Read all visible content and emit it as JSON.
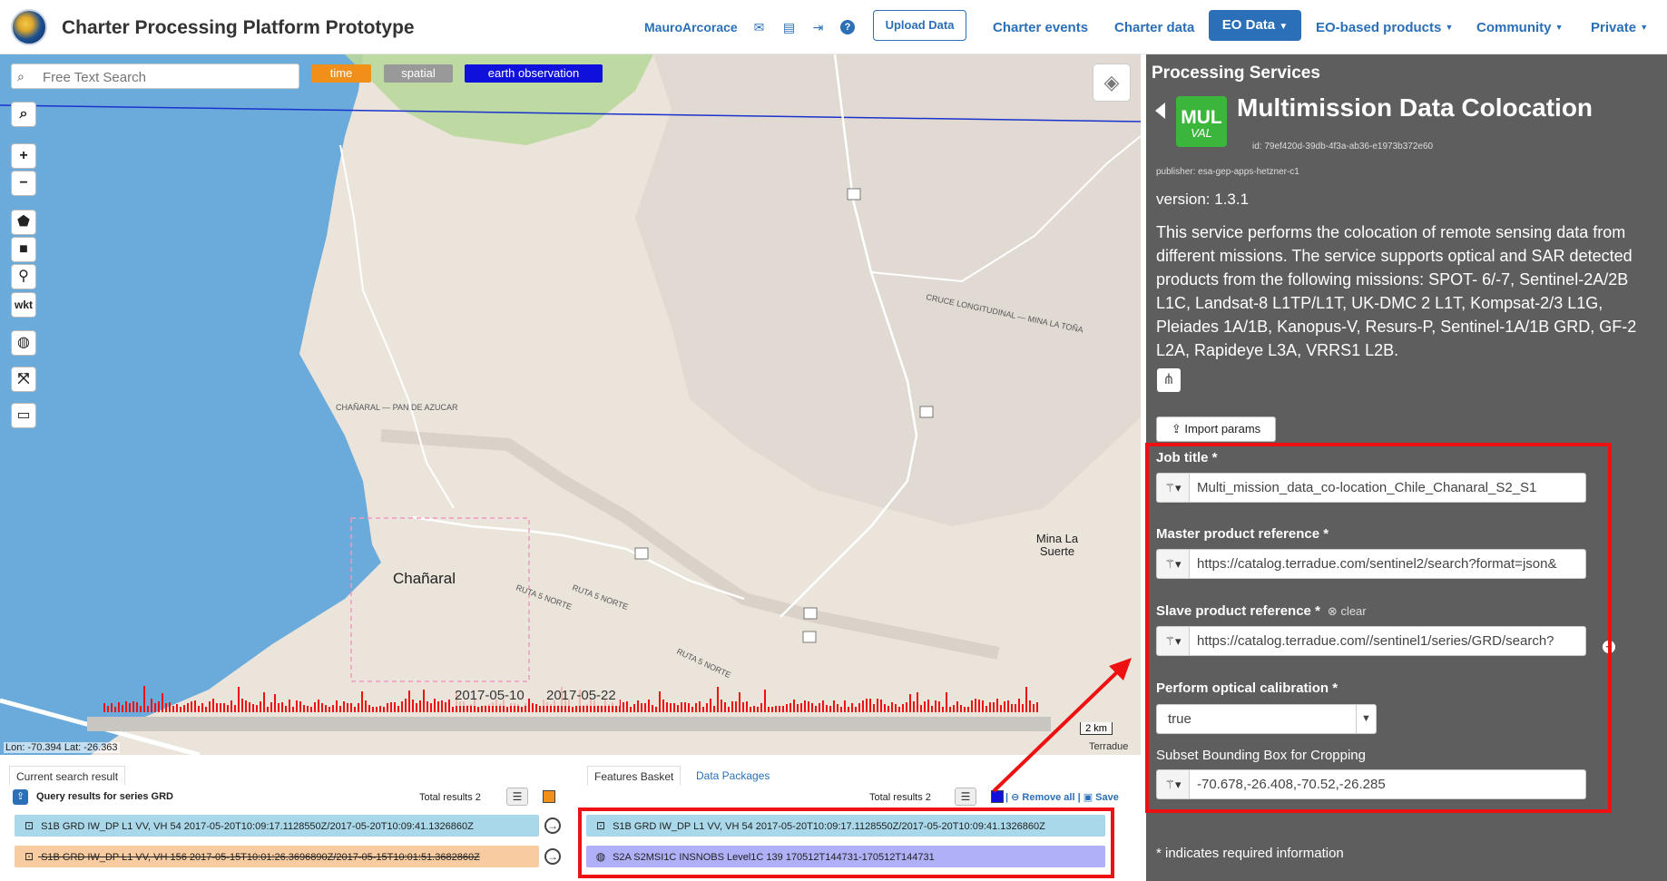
{
  "header": {
    "title": "Charter Processing Platform Prototype",
    "user": "MauroArcorace",
    "upload_label": "Upload Data",
    "nav": [
      "Charter events",
      "Charter data",
      "EO Data",
      "EO-based products",
      "Community",
      "Private"
    ]
  },
  "map": {
    "search_placeholder": "Free Text Search",
    "tags": [
      "time",
      "spatial",
      "earth observation"
    ],
    "tools": {
      "wkt": "wkt"
    },
    "timeline": {
      "start_date": "2017-05-10",
      "end_date": "2017-05-22"
    },
    "coords": "Lon: -70.394 Lat: -26.363",
    "scale": "2 km",
    "attribution": "Terradue",
    "places": {
      "town": "Chañaral",
      "locality": "Mina La Suerte"
    }
  },
  "panel": {
    "section_title": "Processing Services",
    "badge_top": "MUL",
    "badge_bottom": "VAL",
    "service_title": "Multimission Data Colocation",
    "service_id": "id: 79ef420d-39db-4f3a-ab36-e1973b372e60",
    "publisher": "publisher: esa-gep-apps-hetzner-c1",
    "version": "version: 1.3.1",
    "description": "This service performs the colocation of remote sensing data from different missions. The service supports optical and SAR detected products from the following missions: SPOT- 6/-7, Sentinel-2A/2B L1C, Landsat-8 L1TP/L1T, UK-DMC 2 L1T, Kompsat-2/3 L1G, Pleiades 1A/1B, Kanopus-V, Resurs-P, Sentinel-1A/1B GRD, GF-2 L2A, Rapideye L3A, VRRS1 L2B.",
    "import_label": "Import params",
    "fields": {
      "job_title_label": "Job title *",
      "job_title_value": "Multi_mission_data_co-location_Chile_Chanaral_S2_S1",
      "master_label": "Master product reference *",
      "master_value": "https://catalog.terradue.com/sentinel2/search?format=json&",
      "slave_label": "Slave product reference *",
      "slave_clear": "clear",
      "slave_value": "https://catalog.terradue.com//sentinel1/series/GRD/search?",
      "calib_label": "Perform optical calibration *",
      "calib_value": "true",
      "bbox_label": "Subset Bounding Box for Cropping",
      "bbox_value": "-70.678,-26.408,-70.52,-26.285"
    },
    "required_note": "* indicates required information"
  },
  "results": {
    "tab_current": "Current search result",
    "query_title": "Query results for series GRD",
    "total": "Total results  2",
    "rows": [
      "S1B GRD IW_DP L1 VV, VH 54 2017-05-20T10:09:17.1128550Z/2017-05-20T10:09:41.1326860Z",
      "S1B GRD IW_DP L1 VV, VH 156 2017-05-15T10:01:26.3696890Z/2017-05-15T10:01:51.3682860Z"
    ]
  },
  "basket": {
    "tab_basket": "Features Basket",
    "tab_packages": "Data Packages",
    "total": "Total results  2",
    "remove_all": "Remove all",
    "save": "Save",
    "rows": [
      "S1B GRD IW_DP L1 VV, VH 54 2017-05-20T10:09:17.1128550Z/2017-05-20T10:09:41.1326860Z",
      "S2A S2MSI1C INSNOBS Level1C 139 170512T144731-170512T144731"
    ]
  },
  "colors": {
    "accent": "#2a6fb8",
    "highlight": "#e11111",
    "panel": "#5e5e5e",
    "badge": "#3cb63a"
  }
}
